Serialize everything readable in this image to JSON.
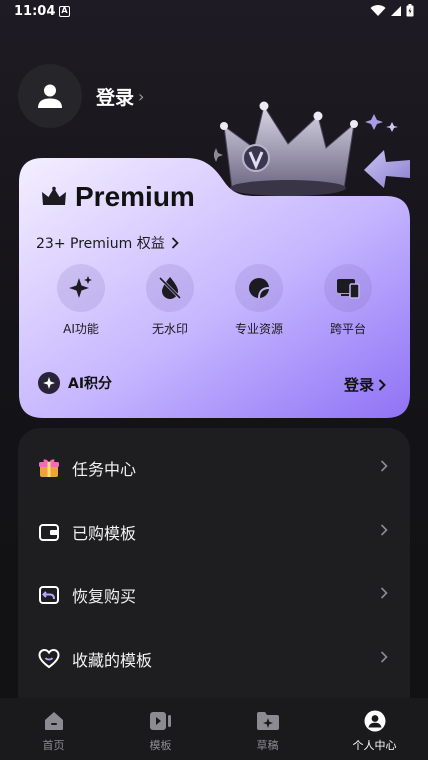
{
  "status_bar": {
    "time": "11:04",
    "notification_glyph": "A"
  },
  "header": {
    "login_label": "登录",
    "chevron": "›"
  },
  "premium": {
    "title": "Premium",
    "benefits": "23+ Premium 权益",
    "features": [
      {
        "label": "AI功能",
        "icon": "sparkle-icon"
      },
      {
        "label": "无水印",
        "icon": "no-watermark-icon"
      },
      {
        "label": "专业资源",
        "icon": "pro-resources-icon"
      },
      {
        "label": "跨平台",
        "icon": "devices-icon"
      }
    ],
    "ai_points_label": "AI积分",
    "login_label": "登录"
  },
  "menu": {
    "items": [
      {
        "label": "任务中心",
        "icon": "gift-icon"
      },
      {
        "label": "已购模板",
        "icon": "wallet-icon"
      },
      {
        "label": "恢复购买",
        "icon": "restore-icon"
      },
      {
        "label": "收藏的模板",
        "icon": "heart-icon"
      }
    ]
  },
  "nav": {
    "items": [
      {
        "label": "首页",
        "icon": "home-icon"
      },
      {
        "label": "模板",
        "icon": "template-icon"
      },
      {
        "label": "草稿",
        "icon": "drafts-icon"
      },
      {
        "label": "个人中心",
        "icon": "profile-icon"
      }
    ],
    "active_index": 3
  },
  "colors": {
    "card_gradient_start": "#f4efff",
    "card_gradient_end": "#8f72f5",
    "background": "#131215",
    "menu_background": "#1e1e21"
  }
}
